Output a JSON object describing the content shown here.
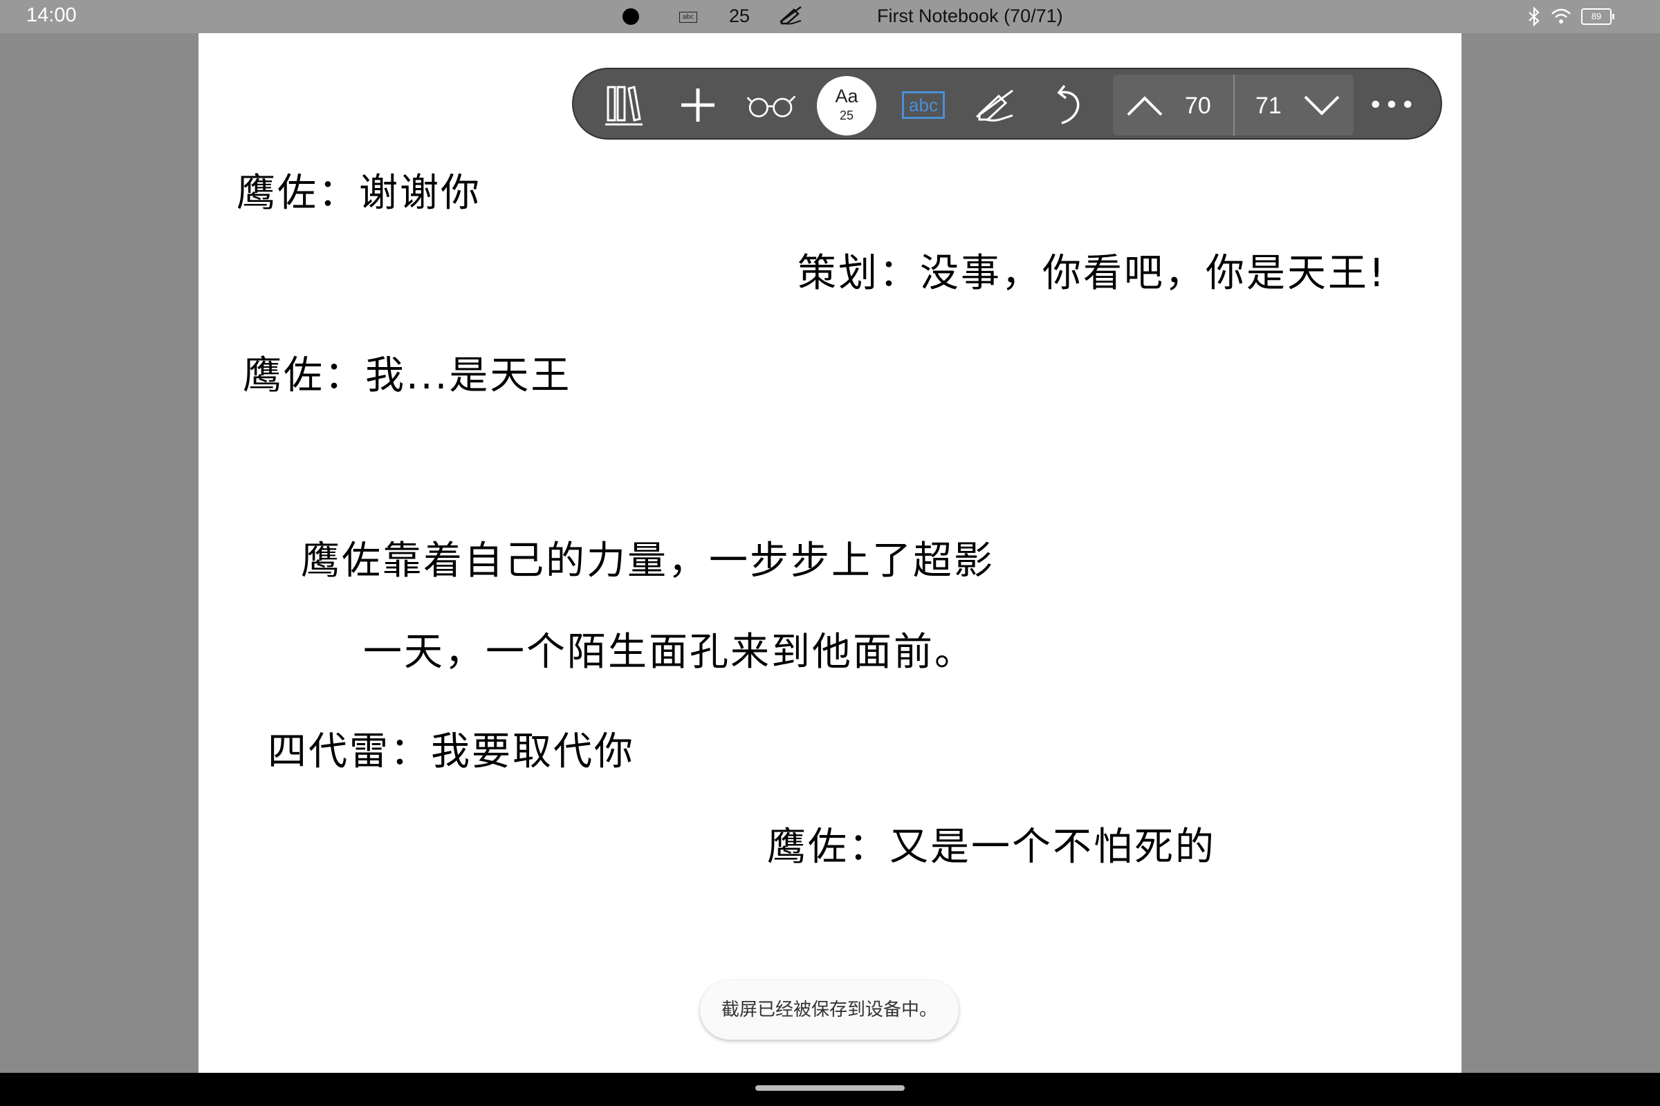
{
  "status_bar": {
    "time": "14:00",
    "font_size": "25",
    "title": "First Notebook (70/71)",
    "battery": "89",
    "abc_label": "abc",
    "icons": [
      "record-dot-icon",
      "abc-icon",
      "pen-off-icon",
      "bluetooth-icon",
      "wifi-icon",
      "battery-icon"
    ]
  },
  "toolbar": {
    "library_icon": "library-icon",
    "add_icon": "plus-icon",
    "glasses_icon": "glasses-icon",
    "font_button": {
      "label": "Aa",
      "size": "25"
    },
    "abc_label": "abc",
    "pen_off_icon": "pen-off-icon",
    "undo_icon": "undo-icon",
    "current_page": "70",
    "total_pages": "71",
    "more_label": "•••",
    "accent_color": "#4a90d9"
  },
  "content": {
    "lines": [
      "鹰佐：谢谢你",
      "策划：没事，你看吧，你是天王!",
      "鹰佐：我...是天王",
      "鹰佐靠着自己的力量，一步步上了超影",
      "一天，一个陌生面孔来到他面前。",
      "四代雷：我要取代你",
      "鹰佐：又是一个不怕死的"
    ]
  },
  "toast": {
    "message": "截屏已经被保存到设备中。"
  }
}
